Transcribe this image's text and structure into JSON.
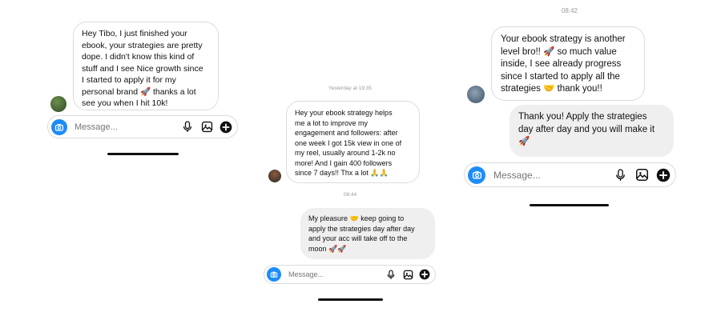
{
  "screens": [
    {
      "messages": [
        {
          "direction": "incoming",
          "text": "Hey Tibo, I just finished your\nebook, your strategies are pretty\ndope. I didn't know this kind of\nstuff and I see Nice growth since\nI started to apply it for my\npersonal brand 🚀 thanks a lot\nsee you when I hit 10k!"
        }
      ],
      "composer": {
        "placeholder": "Message..."
      }
    },
    {
      "timestamp_top": "Yesterday at 19:35",
      "messages": [
        {
          "direction": "incoming",
          "text": "Hey your ebook strategy helps\nme a lot to improve my\nengagement and followers: after\none week I got 15k view in one of\nmy reel, usually around 1-2k no\nmore! And I gain 400 followers\nsince 7 days!! Thx a lot 🙏🙏"
        },
        {
          "direction": "outgoing",
          "text": "My pleasure 🤝 keep going to\napply the strategies day after day\nand your acc will take off to the\nmoon 🚀🚀"
        }
      ],
      "timestamp_mid": "08:44",
      "composer": {
        "placeholder": "Message..."
      }
    },
    {
      "timestamp_top": "08:42",
      "messages": [
        {
          "direction": "incoming",
          "text": "Your ebook strategy is another\nlevel bro!! 🚀 so much value\ninside, I see already progress\nsince I started to apply all the\nstrategies 🤝 thank you!!"
        },
        {
          "direction": "outgoing",
          "text": "Thank you! Apply the strategies\nday after day and you will make it\n🚀"
        }
      ],
      "composer": {
        "placeholder": "Message..."
      }
    }
  ],
  "colors": {
    "accent": "#1d8cf8",
    "incoming_bg": "#ffffff",
    "outgoing_bg": "#efefef",
    "timestamp": "#9a9a9a"
  }
}
